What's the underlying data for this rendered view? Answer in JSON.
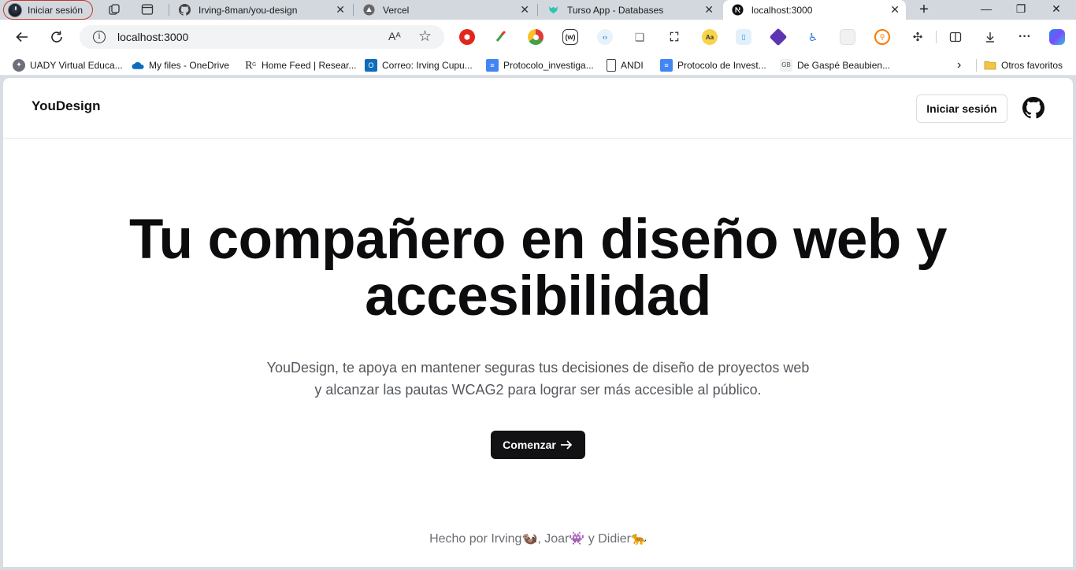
{
  "browser": {
    "profile_label": "Iniciar sesión",
    "tabs": [
      {
        "title": "Irving-8man/you-design",
        "icon": "github-icon"
      },
      {
        "title": "Vercel",
        "icon": "vercel-icon"
      },
      {
        "title": "Turso App - Databases",
        "icon": "turso-icon"
      },
      {
        "title": "localhost:3000",
        "icon": "nextjs-icon",
        "active": true
      }
    ],
    "new_tab": "+",
    "address": "localhost:3000",
    "read_aloud": "Aᴬ",
    "bookmarks": [
      "UADY Virtual Educa...",
      "My files - OneDrive",
      "Home Feed | Resear...",
      "Correo: Irving Cupu...",
      "Protocolo_investiga...",
      "ANDI",
      "Protocolo de Invest...",
      "De Gaspé Beaubien..."
    ],
    "bookmarks_more": "›",
    "other_favorites": "Otros favoritos"
  },
  "site": {
    "brand": "YouDesign",
    "signin_label": "Iniciar sesión",
    "hero_title_line1": "Tu compañero en diseño web y",
    "hero_title_line2": "accesibilidad",
    "hero_sub_line1": "YouDesign, te apoya en mantener seguras tus decisiones de diseño de proyectos web",
    "hero_sub_line2": "y alcanzar las pautas WCAG2 para lograr ser más accesible al público.",
    "cta_label": "Comenzar",
    "footer_text": "Hecho por Irving🦦, Joar👾 y Didier🐆"
  },
  "colors": {
    "cta_bg": "#121214",
    "text_primary": "#0c0c0f",
    "text_muted": "#55585e"
  }
}
